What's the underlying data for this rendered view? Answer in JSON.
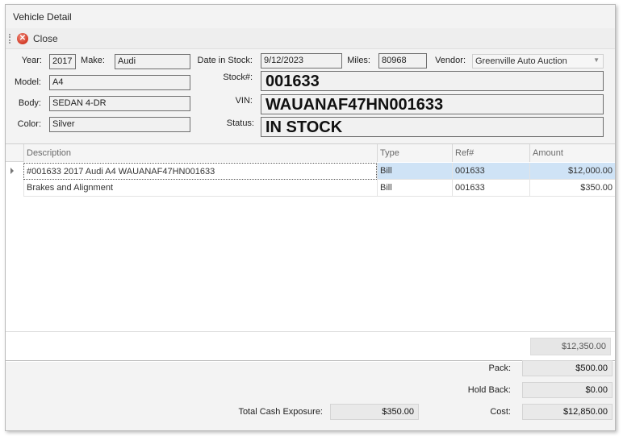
{
  "window": {
    "title": "Vehicle Detail"
  },
  "toolbar": {
    "close_label": "Close",
    "close_icon": "close-icon"
  },
  "labels": {
    "year": "Year:",
    "make": "Make:",
    "date_in_stock": "Date in Stock:",
    "miles": "Miles:",
    "vendor": "Vendor:",
    "model": "Model:",
    "body": "Body:",
    "color": "Color:",
    "stock": "Stock#:",
    "vin": "VIN:",
    "status": "Status:"
  },
  "vehicle": {
    "year": "2017",
    "make": "Audi",
    "date_in_stock": "9/12/2023",
    "miles": "80968",
    "vendor": "Greenville Auto Auction",
    "model": "A4",
    "body": "SEDAN 4-DR",
    "color": "Silver",
    "stock": "001633",
    "vin": "WAUANAF47HN001633",
    "status": "IN STOCK"
  },
  "grid": {
    "columns": [
      "Description",
      "Type",
      "Ref#",
      "Amount"
    ],
    "rows": [
      {
        "description": "#001633 2017 Audi A4 WAUANAF47HN001633",
        "type": "Bill",
        "ref": "001633",
        "amount": "$12,000.00"
      },
      {
        "description": "Brakes and Alignment",
        "type": "Bill",
        "ref": "001633",
        "amount": "$350.00"
      }
    ],
    "total": "$12,350.00"
  },
  "summary": {
    "pack_label": "Pack:",
    "pack": "$500.00",
    "hold_back_label": "Hold Back:",
    "hold_back": "$0.00",
    "cost_label": "Cost:",
    "cost": "$12,850.00",
    "total_cash_exposure_label": "Total Cash Exposure:",
    "total_cash_exposure": "$350.00"
  }
}
